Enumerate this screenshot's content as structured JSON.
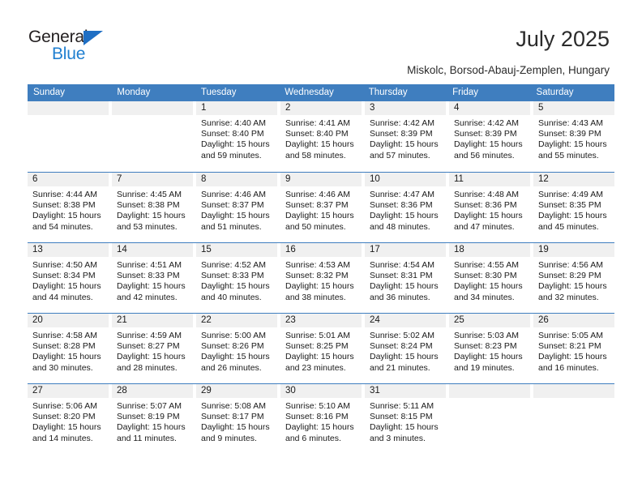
{
  "logo": {
    "word_top": "General",
    "word_bottom": "Blue",
    "triangle_color": "#1f6fc4",
    "blue_text_color": "#1f7fd0"
  },
  "header": {
    "title": "July 2025",
    "subtitle": "Miskolc, Borsod-Abauj-Zemplen, Hungary"
  },
  "theme": {
    "header_blue": "#3f7ebf",
    "daynum_band": "#f0f0f0"
  },
  "calendar": {
    "weekday_headers": [
      "Sunday",
      "Monday",
      "Tuesday",
      "Wednesday",
      "Thursday",
      "Friday",
      "Saturday"
    ],
    "weeks": [
      [
        {
          "day": "",
          "sunrise": "",
          "sunset": "",
          "daylight_line1": "",
          "daylight_line2": ""
        },
        {
          "day": "",
          "sunrise": "",
          "sunset": "",
          "daylight_line1": "",
          "daylight_line2": ""
        },
        {
          "day": "1",
          "sunrise": "Sunrise: 4:40 AM",
          "sunset": "Sunset: 8:40 PM",
          "daylight_line1": "Daylight: 15 hours",
          "daylight_line2": "and 59 minutes."
        },
        {
          "day": "2",
          "sunrise": "Sunrise: 4:41 AM",
          "sunset": "Sunset: 8:40 PM",
          "daylight_line1": "Daylight: 15 hours",
          "daylight_line2": "and 58 minutes."
        },
        {
          "day": "3",
          "sunrise": "Sunrise: 4:42 AM",
          "sunset": "Sunset: 8:39 PM",
          "daylight_line1": "Daylight: 15 hours",
          "daylight_line2": "and 57 minutes."
        },
        {
          "day": "4",
          "sunrise": "Sunrise: 4:42 AM",
          "sunset": "Sunset: 8:39 PM",
          "daylight_line1": "Daylight: 15 hours",
          "daylight_line2": "and 56 minutes."
        },
        {
          "day": "5",
          "sunrise": "Sunrise: 4:43 AM",
          "sunset": "Sunset: 8:39 PM",
          "daylight_line1": "Daylight: 15 hours",
          "daylight_line2": "and 55 minutes."
        }
      ],
      [
        {
          "day": "6",
          "sunrise": "Sunrise: 4:44 AM",
          "sunset": "Sunset: 8:38 PM",
          "daylight_line1": "Daylight: 15 hours",
          "daylight_line2": "and 54 minutes."
        },
        {
          "day": "7",
          "sunrise": "Sunrise: 4:45 AM",
          "sunset": "Sunset: 8:38 PM",
          "daylight_line1": "Daylight: 15 hours",
          "daylight_line2": "and 53 minutes."
        },
        {
          "day": "8",
          "sunrise": "Sunrise: 4:46 AM",
          "sunset": "Sunset: 8:37 PM",
          "daylight_line1": "Daylight: 15 hours",
          "daylight_line2": "and 51 minutes."
        },
        {
          "day": "9",
          "sunrise": "Sunrise: 4:46 AM",
          "sunset": "Sunset: 8:37 PM",
          "daylight_line1": "Daylight: 15 hours",
          "daylight_line2": "and 50 minutes."
        },
        {
          "day": "10",
          "sunrise": "Sunrise: 4:47 AM",
          "sunset": "Sunset: 8:36 PM",
          "daylight_line1": "Daylight: 15 hours",
          "daylight_line2": "and 48 minutes."
        },
        {
          "day": "11",
          "sunrise": "Sunrise: 4:48 AM",
          "sunset": "Sunset: 8:36 PM",
          "daylight_line1": "Daylight: 15 hours",
          "daylight_line2": "and 47 minutes."
        },
        {
          "day": "12",
          "sunrise": "Sunrise: 4:49 AM",
          "sunset": "Sunset: 8:35 PM",
          "daylight_line1": "Daylight: 15 hours",
          "daylight_line2": "and 45 minutes."
        }
      ],
      [
        {
          "day": "13",
          "sunrise": "Sunrise: 4:50 AM",
          "sunset": "Sunset: 8:34 PM",
          "daylight_line1": "Daylight: 15 hours",
          "daylight_line2": "and 44 minutes."
        },
        {
          "day": "14",
          "sunrise": "Sunrise: 4:51 AM",
          "sunset": "Sunset: 8:33 PM",
          "daylight_line1": "Daylight: 15 hours",
          "daylight_line2": "and 42 minutes."
        },
        {
          "day": "15",
          "sunrise": "Sunrise: 4:52 AM",
          "sunset": "Sunset: 8:33 PM",
          "daylight_line1": "Daylight: 15 hours",
          "daylight_line2": "and 40 minutes."
        },
        {
          "day": "16",
          "sunrise": "Sunrise: 4:53 AM",
          "sunset": "Sunset: 8:32 PM",
          "daylight_line1": "Daylight: 15 hours",
          "daylight_line2": "and 38 minutes."
        },
        {
          "day": "17",
          "sunrise": "Sunrise: 4:54 AM",
          "sunset": "Sunset: 8:31 PM",
          "daylight_line1": "Daylight: 15 hours",
          "daylight_line2": "and 36 minutes."
        },
        {
          "day": "18",
          "sunrise": "Sunrise: 4:55 AM",
          "sunset": "Sunset: 8:30 PM",
          "daylight_line1": "Daylight: 15 hours",
          "daylight_line2": "and 34 minutes."
        },
        {
          "day": "19",
          "sunrise": "Sunrise: 4:56 AM",
          "sunset": "Sunset: 8:29 PM",
          "daylight_line1": "Daylight: 15 hours",
          "daylight_line2": "and 32 minutes."
        }
      ],
      [
        {
          "day": "20",
          "sunrise": "Sunrise: 4:58 AM",
          "sunset": "Sunset: 8:28 PM",
          "daylight_line1": "Daylight: 15 hours",
          "daylight_line2": "and 30 minutes."
        },
        {
          "day": "21",
          "sunrise": "Sunrise: 4:59 AM",
          "sunset": "Sunset: 8:27 PM",
          "daylight_line1": "Daylight: 15 hours",
          "daylight_line2": "and 28 minutes."
        },
        {
          "day": "22",
          "sunrise": "Sunrise: 5:00 AM",
          "sunset": "Sunset: 8:26 PM",
          "daylight_line1": "Daylight: 15 hours",
          "daylight_line2": "and 26 minutes."
        },
        {
          "day": "23",
          "sunrise": "Sunrise: 5:01 AM",
          "sunset": "Sunset: 8:25 PM",
          "daylight_line1": "Daylight: 15 hours",
          "daylight_line2": "and 23 minutes."
        },
        {
          "day": "24",
          "sunrise": "Sunrise: 5:02 AM",
          "sunset": "Sunset: 8:24 PM",
          "daylight_line1": "Daylight: 15 hours",
          "daylight_line2": "and 21 minutes."
        },
        {
          "day": "25",
          "sunrise": "Sunrise: 5:03 AM",
          "sunset": "Sunset: 8:23 PM",
          "daylight_line1": "Daylight: 15 hours",
          "daylight_line2": "and 19 minutes."
        },
        {
          "day": "26",
          "sunrise": "Sunrise: 5:05 AM",
          "sunset": "Sunset: 8:21 PM",
          "daylight_line1": "Daylight: 15 hours",
          "daylight_line2": "and 16 minutes."
        }
      ],
      [
        {
          "day": "27",
          "sunrise": "Sunrise: 5:06 AM",
          "sunset": "Sunset: 8:20 PM",
          "daylight_line1": "Daylight: 15 hours",
          "daylight_line2": "and 14 minutes."
        },
        {
          "day": "28",
          "sunrise": "Sunrise: 5:07 AM",
          "sunset": "Sunset: 8:19 PM",
          "daylight_line1": "Daylight: 15 hours",
          "daylight_line2": "and 11 minutes."
        },
        {
          "day": "29",
          "sunrise": "Sunrise: 5:08 AM",
          "sunset": "Sunset: 8:17 PM",
          "daylight_line1": "Daylight: 15 hours",
          "daylight_line2": "and 9 minutes."
        },
        {
          "day": "30",
          "sunrise": "Sunrise: 5:10 AM",
          "sunset": "Sunset: 8:16 PM",
          "daylight_line1": "Daylight: 15 hours",
          "daylight_line2": "and 6 minutes."
        },
        {
          "day": "31",
          "sunrise": "Sunrise: 5:11 AM",
          "sunset": "Sunset: 8:15 PM",
          "daylight_line1": "Daylight: 15 hours",
          "daylight_line2": "and 3 minutes."
        },
        {
          "day": "",
          "sunrise": "",
          "sunset": "",
          "daylight_line1": "",
          "daylight_line2": ""
        },
        {
          "day": "",
          "sunrise": "",
          "sunset": "",
          "daylight_line1": "",
          "daylight_line2": ""
        }
      ]
    ]
  }
}
